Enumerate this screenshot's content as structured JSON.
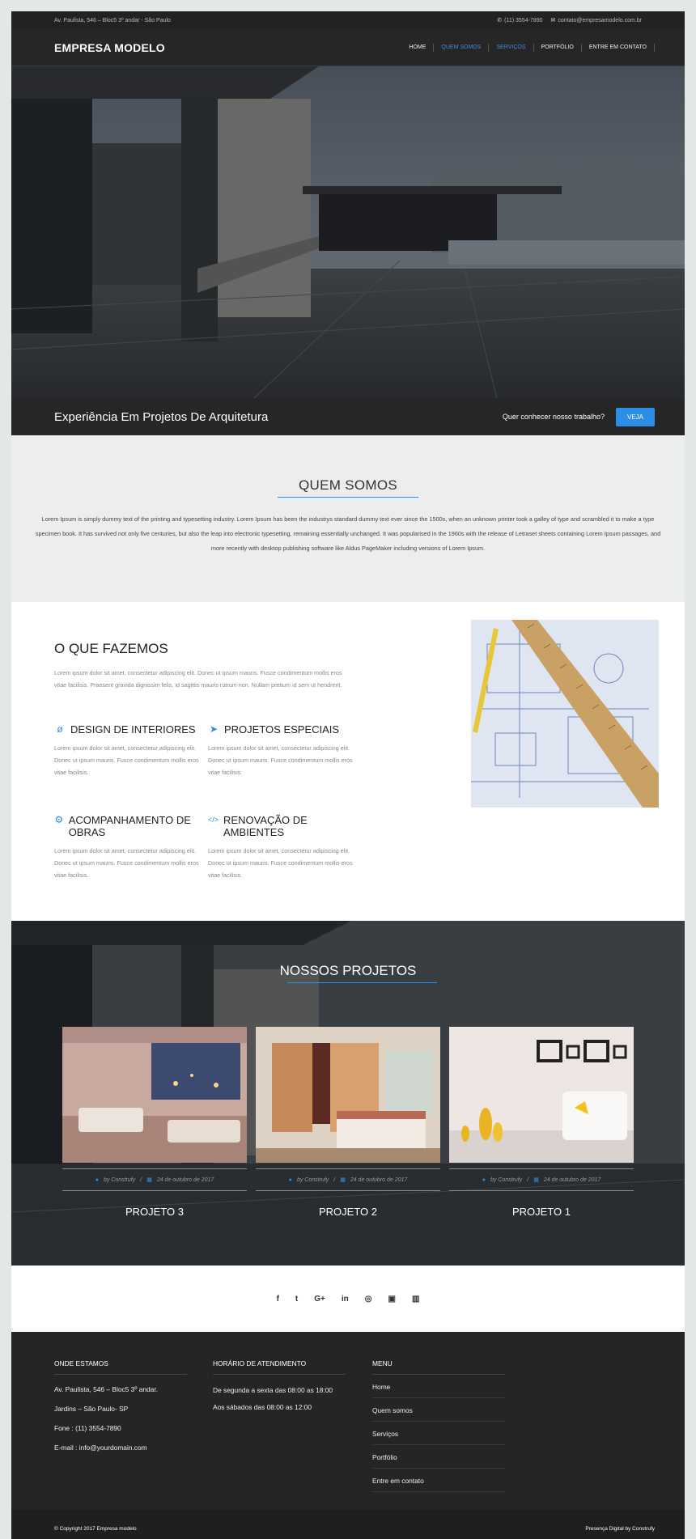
{
  "topbar": {
    "address": "Av. Paulista, 546 – Bloc5 3º andar - São Paulo",
    "phone": "(11) 3554-7890",
    "email": "contato@empresamodelo.com.br"
  },
  "nav": {
    "brand": "EMPRESA MODELO",
    "items": [
      "HOME",
      "QUEM SOMOS",
      "SERVIÇOS",
      "PORTFÓLIO",
      "ENTRE EM CONTATO"
    ]
  },
  "hero": {
    "title": "Experiência Em Projetos De Arquitetura",
    "question": "Quer conhecer nosso trabalho?",
    "button": "VEJA"
  },
  "about": {
    "title": "QUEM SOMOS",
    "text": "Lorem Ipsum is simply dummy text of the printing and typesetting industry. Lorem Ipsum has been the industrys standard dummy text ever since the 1500s, when an unknown printer took a galley of type and scrambled it to make a type specimen book. It has survived not only five centuries, but also the leap into electronic typesetting, remaining essentially unchanged. It was popularised in the 1960s with the release of Letraset sheets containing Lorem Ipsum passages, and more recently with desktop publishing software like Aldus PageMaker including versions of Lorem Ipsum."
  },
  "services": {
    "title": "O QUE FAZEMOS",
    "intro": "Lorem ipsum dolor sit amet, consectetur adipiscing elit. Donec ut ipsum mauris. Fusce condimentum mollis eros vitae facilisis. Praesent gravida dignissim felis, id sagittis mauris rutrum non. Nullam pretium id sem ut hendrerit.",
    "items": [
      {
        "title": "DESIGN DE INTERIORES",
        "icon": "ø",
        "text": "Lorem ipsum dolor sit amet, consectetur adipiscing elit. Donec ut ipsum mauris. Fusce condimentum mollis eros vitae facilisis."
      },
      {
        "title": "PROJETOS ESPECIAIS",
        "icon": "➤",
        "text": "Lorem ipsum dolor sit amet, consectetur adipiscing elit. Donec ut ipsum mauris. Fusce condimentum mollis eros vitae facilisis."
      },
      {
        "title": "ACOMPANHAMENTO DE OBRAS",
        "icon": "⚙",
        "text": "Lorem ipsum dolor sit amet, consectetur adipiscing elit. Donec ut ipsum mauris. Fusce condimentum mollis eros vitae facilisis."
      },
      {
        "title": "RENOVAÇÃO DE AMBIENTES",
        "icon": "</>",
        "text": "Lorem ipsum dolor sit amet, consectetur adipiscing elit. Donec ut ipsum mauris. Fusce condimentum mollis eros vitae facilisis."
      }
    ]
  },
  "projects": {
    "title": "NOSSOS PROJETOS",
    "items": [
      {
        "name": "PROJETO 3",
        "author": "by Construfy",
        "date": "24 de outubro de 2017"
      },
      {
        "name": "PROJETO 2",
        "author": "by Construfy",
        "date": "24 de outubro de 2017"
      },
      {
        "name": "PROJETO 1",
        "author": "by Construfy",
        "date": "24 de outubro de 2017"
      }
    ]
  },
  "social": [
    "f",
    "t",
    "G+",
    "in",
    "◎",
    "▣",
    "▥"
  ],
  "footer": {
    "col1": {
      "title": "ONDE ESTAMOS",
      "lines": [
        "Av. Paulista, 546 – Bloc5 3º andar.",
        "Jardins – São Paulo- SP",
        "Fone   : (11) 3554-7890",
        "E-mail : info@yourdomain.com"
      ]
    },
    "col2": {
      "title": "HORÁRIO DE ATENDIMENTO",
      "lines": [
        "De segunda a sexta das 08:00 as 18:00",
        "Aos sábados das 08:00 as 12:00"
      ]
    },
    "col3": {
      "title": "MENU",
      "links": [
        "Home",
        "Quem somos",
        "Serviços",
        "Portfólio",
        "Entre em contato"
      ]
    },
    "copyright": "© Copyright 2017 Empresa modelo",
    "credit": "Presença Digital by Construfy"
  },
  "colors": {
    "accent": "#2b8fe6",
    "dark": "#262626"
  }
}
